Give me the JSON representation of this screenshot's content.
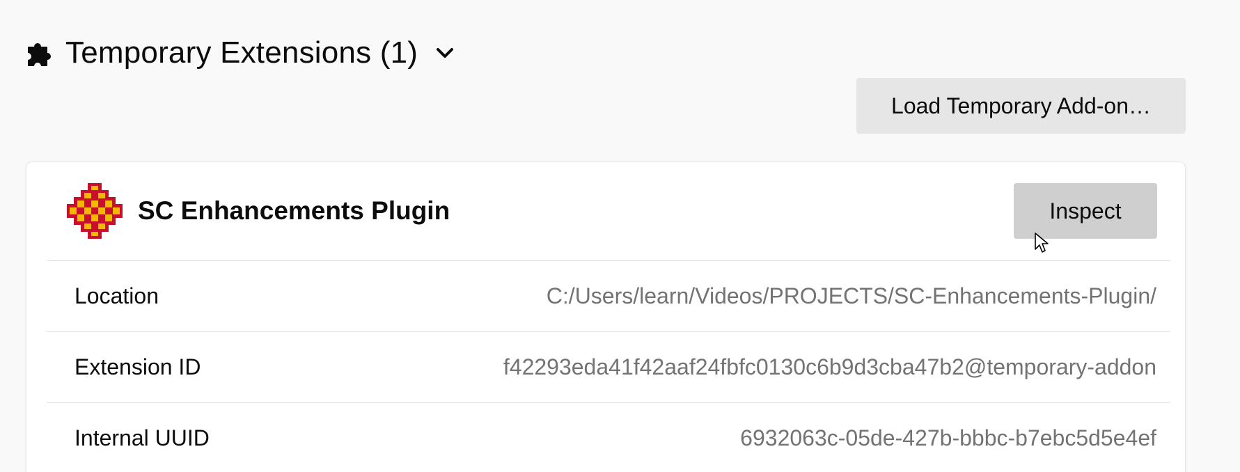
{
  "section": {
    "title": "Temporary Extensions (1)",
    "icon": "puzzle-piece-icon",
    "toggle_icon": "chevron-down-icon"
  },
  "toolbar": {
    "load_label": "Load Temporary Add-on…"
  },
  "addon": {
    "name": "SC Enhancements Plugin",
    "icon": "addon-logo-icon",
    "inspect_label": "Inspect",
    "details": [
      {
        "label": "Location",
        "value": "C:/Users/learn/Videos/PROJECTS/SC-Enhancements-Plugin/"
      },
      {
        "label": "Extension ID",
        "value": "f42293eda41f42aaf24fbfc0130c6b9d3cba47b2@temporary-addon"
      },
      {
        "label": "Internal UUID",
        "value": "6932063c-05de-427b-bbbc-b7ebc5d5e4ef"
      }
    ]
  },
  "colors": {
    "background": "#f9f9fa",
    "card": "#ffffff",
    "load_button": "#e6e6e6",
    "inspect_button_hover": "#cfcfcf",
    "muted_text": "#737373",
    "logo_red": "#c8102e",
    "logo_yellow": "#f5b800"
  }
}
